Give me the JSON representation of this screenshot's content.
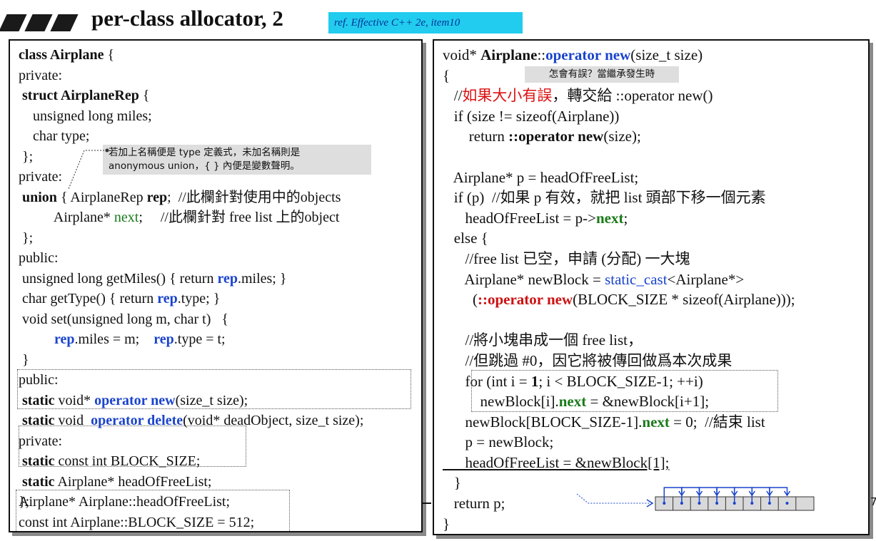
{
  "header": {
    "title": "per-class allocator, 2",
    "ref": "ref. Effective C++ 2e, item10"
  },
  "left_code": [
    [
      {
        "t": "class Airplane",
        "c": "b"
      },
      {
        "t": " {"
      }
    ],
    [
      {
        "t": "private:"
      }
    ],
    [
      {
        "t": " struct AirplaneRep",
        "c": "b"
      },
      {
        "t": " {"
      }
    ],
    [
      {
        "t": "    unsigned long miles;"
      }
    ],
    [
      {
        "t": "    char type;"
      }
    ],
    [
      {
        "t": " };"
      }
    ],
    [
      {
        "t": "private:"
      }
    ],
    [
      {
        "t": " union",
        "c": "b"
      },
      {
        "t": " { AirplaneRep "
      },
      {
        "t": "rep",
        "c": "b"
      },
      {
        "t": ";  //此欄針對使用中的objects"
      }
    ],
    [
      {
        "t": "          Airplane* "
      },
      {
        "t": "next",
        "c": "green"
      },
      {
        "t": ";     //此欄針對 free list 上的object"
      }
    ],
    [
      {
        "t": " };"
      }
    ],
    [
      {
        "t": "public:"
      }
    ],
    [
      {
        "t": " unsigned long getMiles() { return "
      },
      {
        "t": "rep",
        "c": "b blue"
      },
      {
        "t": ".miles; }"
      }
    ],
    [
      {
        "t": " char getType() { return "
      },
      {
        "t": "rep",
        "c": "b blue"
      },
      {
        "t": ".type; }"
      }
    ],
    [
      {
        "t": " void set(unsigned long m, char t)   {"
      }
    ],
    [
      {
        "t": "          "
      },
      {
        "t": "rep",
        "c": "b blue"
      },
      {
        "t": ".miles = m;    "
      },
      {
        "t": "rep",
        "c": "b blue"
      },
      {
        "t": ".type = t;"
      }
    ],
    [
      {
        "t": " }"
      }
    ],
    [
      {
        "t": "public:"
      }
    ],
    [
      {
        "t": " static",
        "c": "b"
      },
      {
        "t": " void* "
      },
      {
        "t": "operator new",
        "c": "b blue"
      },
      {
        "t": "(size_t size);"
      }
    ],
    [
      {
        "t": " static",
        "c": "b"
      },
      {
        "t": " void  "
      },
      {
        "t": "operator delete",
        "c": "b blue"
      },
      {
        "t": "(void* deadObject, size_t size);"
      }
    ],
    [
      {
        "t": "private:"
      }
    ],
    [
      {
        "t": " static",
        "c": "b"
      },
      {
        "t": " const int BLOCK_SIZE;"
      }
    ],
    [
      {
        "t": " static",
        "c": "b"
      },
      {
        "t": " Airplane* headOfFreeList;"
      }
    ],
    [
      {
        "t": "};"
      }
    ]
  ],
  "left_defs": [
    [
      {
        "t": "Airplane* Airplane::headOfFreeList;"
      }
    ],
    [
      {
        "t": "const int Airplane::BLOCK_SIZE = 512;"
      }
    ]
  ],
  "right_code": [
    [
      {
        "t": "void* "
      },
      {
        "t": "Airplane",
        "c": "b"
      },
      {
        "t": "::"
      },
      {
        "t": "operator new",
        "c": "b blue"
      },
      {
        "t": "(size_t size)"
      }
    ],
    [
      {
        "t": "{"
      }
    ],
    [
      {
        "t": "   //"
      },
      {
        "t": "如果大小有誤",
        "c": "red"
      },
      {
        "t": "，轉交給 ::operator new()"
      }
    ],
    [
      {
        "t": "   if (size != sizeof(Airplane))"
      }
    ],
    [
      {
        "t": "       return "
      },
      {
        "t": "::operator new",
        "c": "b"
      },
      {
        "t": "(size);"
      }
    ],
    [
      {
        "t": ""
      }
    ],
    [
      {
        "t": "   Airplane* p = headOfFreeList;"
      }
    ],
    [
      {
        "t": "   if (p)  //如果 p 有效，就把 list 頭部下移一個元素"
      }
    ],
    [
      {
        "t": "      headOfFreeList = p->"
      },
      {
        "t": "next",
        "c": "b green"
      },
      {
        "t": ";"
      }
    ],
    [
      {
        "t": "   else {"
      }
    ],
    [
      {
        "t": "      //free list 已空，申請 (分配) 一大塊"
      }
    ],
    [
      {
        "t": "      Airplane* newBlock = "
      },
      {
        "t": "static_cast",
        "c": "blue"
      },
      {
        "t": "<Airplane*>"
      }
    ],
    [
      {
        "t": "        ("
      },
      {
        "t": "::operator new",
        "c": "redb"
      },
      {
        "t": "(BLOCK_SIZE * sizeof(Airplane)));"
      }
    ],
    [
      {
        "t": ""
      }
    ],
    [
      {
        "t": "      //將小塊串成一個 free list，"
      }
    ],
    [
      {
        "t": "      //但跳過 #0，因它將被傳回做爲本次成果"
      }
    ],
    [
      {
        "t": "      for (int i = "
      },
      {
        "t": "1",
        "c": "b"
      },
      {
        "t": "; i < BLOCK_SIZE-1; ++i)"
      }
    ],
    [
      {
        "t": "          newBlock[i]."
      },
      {
        "t": "next",
        "c": "b green"
      },
      {
        "t": " = &newBlock[i+1];"
      }
    ],
    [
      {
        "t": "      newBlock[BLOCK_SIZE-1]."
      },
      {
        "t": "next",
        "c": "b green"
      },
      {
        "t": " = 0;  //結束 list"
      }
    ],
    [
      {
        "t": "      p = newBlock;"
      }
    ],
    [
      {
        "t": "      headOfFreeList = &newBlock[1];",
        "c": "ul"
      }
    ],
    [
      {
        "t": "   }"
      }
    ],
    [
      {
        "t": "   return p;"
      }
    ],
    [
      {
        "t": "}"
      }
    ]
  ],
  "notes": {
    "union_note": "若加上名稱便是 type 定義式，未加名稱則是\nanonymous union，{ } 內便是變數聲明。",
    "inherit_note": "怎會有誤？當繼承發生時"
  },
  "page_number": "7"
}
